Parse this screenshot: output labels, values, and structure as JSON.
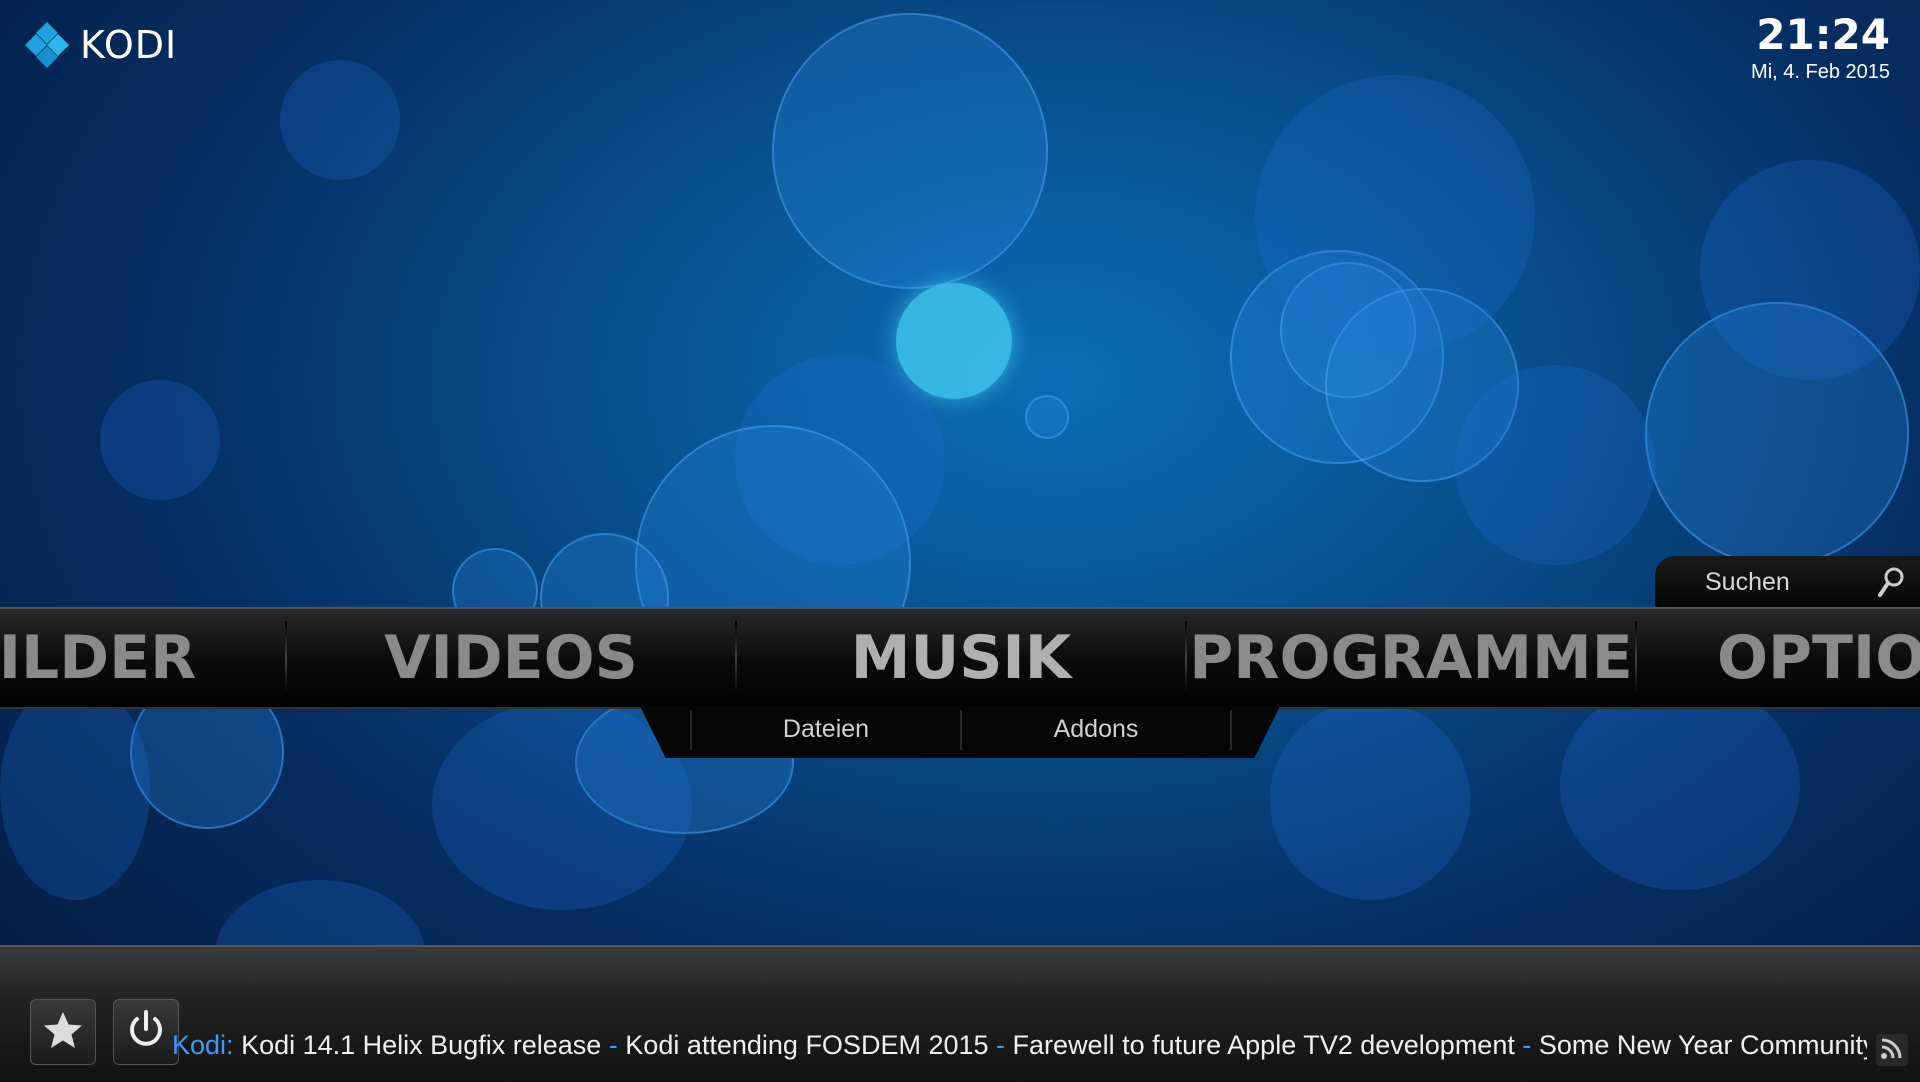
{
  "app": {
    "logo_text": "KODI"
  },
  "clock": {
    "time": "21:24",
    "date": "Mi, 4. Feb 2015"
  },
  "search": {
    "placeholder": "Suchen"
  },
  "main_menu": {
    "items": [
      "ILDER",
      "VIDEOS",
      "MUSIK",
      "PROGRAMME",
      "OPTION"
    ],
    "selected": "MUSIK"
  },
  "submenu": {
    "items": [
      "Dateien",
      "Addons"
    ]
  },
  "footer": {
    "favourites_icon": "star-icon",
    "power_icon": "power-icon",
    "rss_icon": "rss-icon"
  },
  "ticker": {
    "source": "Kodi:",
    "headlines": [
      "Kodi 14.1 Helix Bugfix release",
      "Kodi attending FOSDEM 2015",
      "Farewell to future Apple TV2 development",
      "Some New Year Community Upd"
    ],
    "separator": "-"
  },
  "colors": {
    "accent": "#3a9bff",
    "logo_blue": "#1fa3e0"
  }
}
